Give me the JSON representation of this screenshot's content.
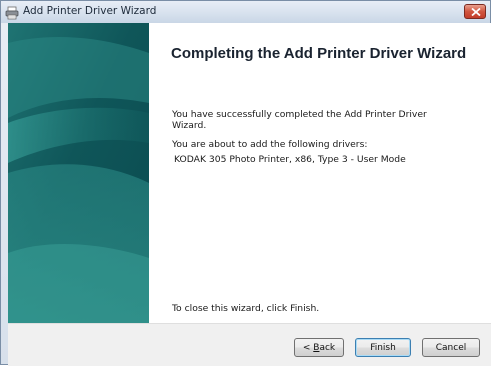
{
  "window": {
    "title": "Add Printer Driver Wizard",
    "title_icon": "printer-icon",
    "close_icon": "close-icon"
  },
  "content": {
    "heading": "Completing the Add Printer Driver Wizard",
    "success_text": "You have successfully completed the Add Printer Driver Wizard.",
    "about_text": "You are about to add the following drivers:",
    "driver_text": "KODAK 305 Photo Printer, x86, Type 3 - User Mode",
    "close_hint": "To close this wizard, click Finish."
  },
  "buttons": {
    "back_prefix": "< ",
    "back_accel": "B",
    "back_rest": "ack",
    "finish_label": "Finish",
    "cancel_label": "Cancel"
  },
  "colors": {
    "sidebar_dark": "#0f5b5e",
    "sidebar_light": "#2f8f8c",
    "close_red": "#c23d2a"
  }
}
